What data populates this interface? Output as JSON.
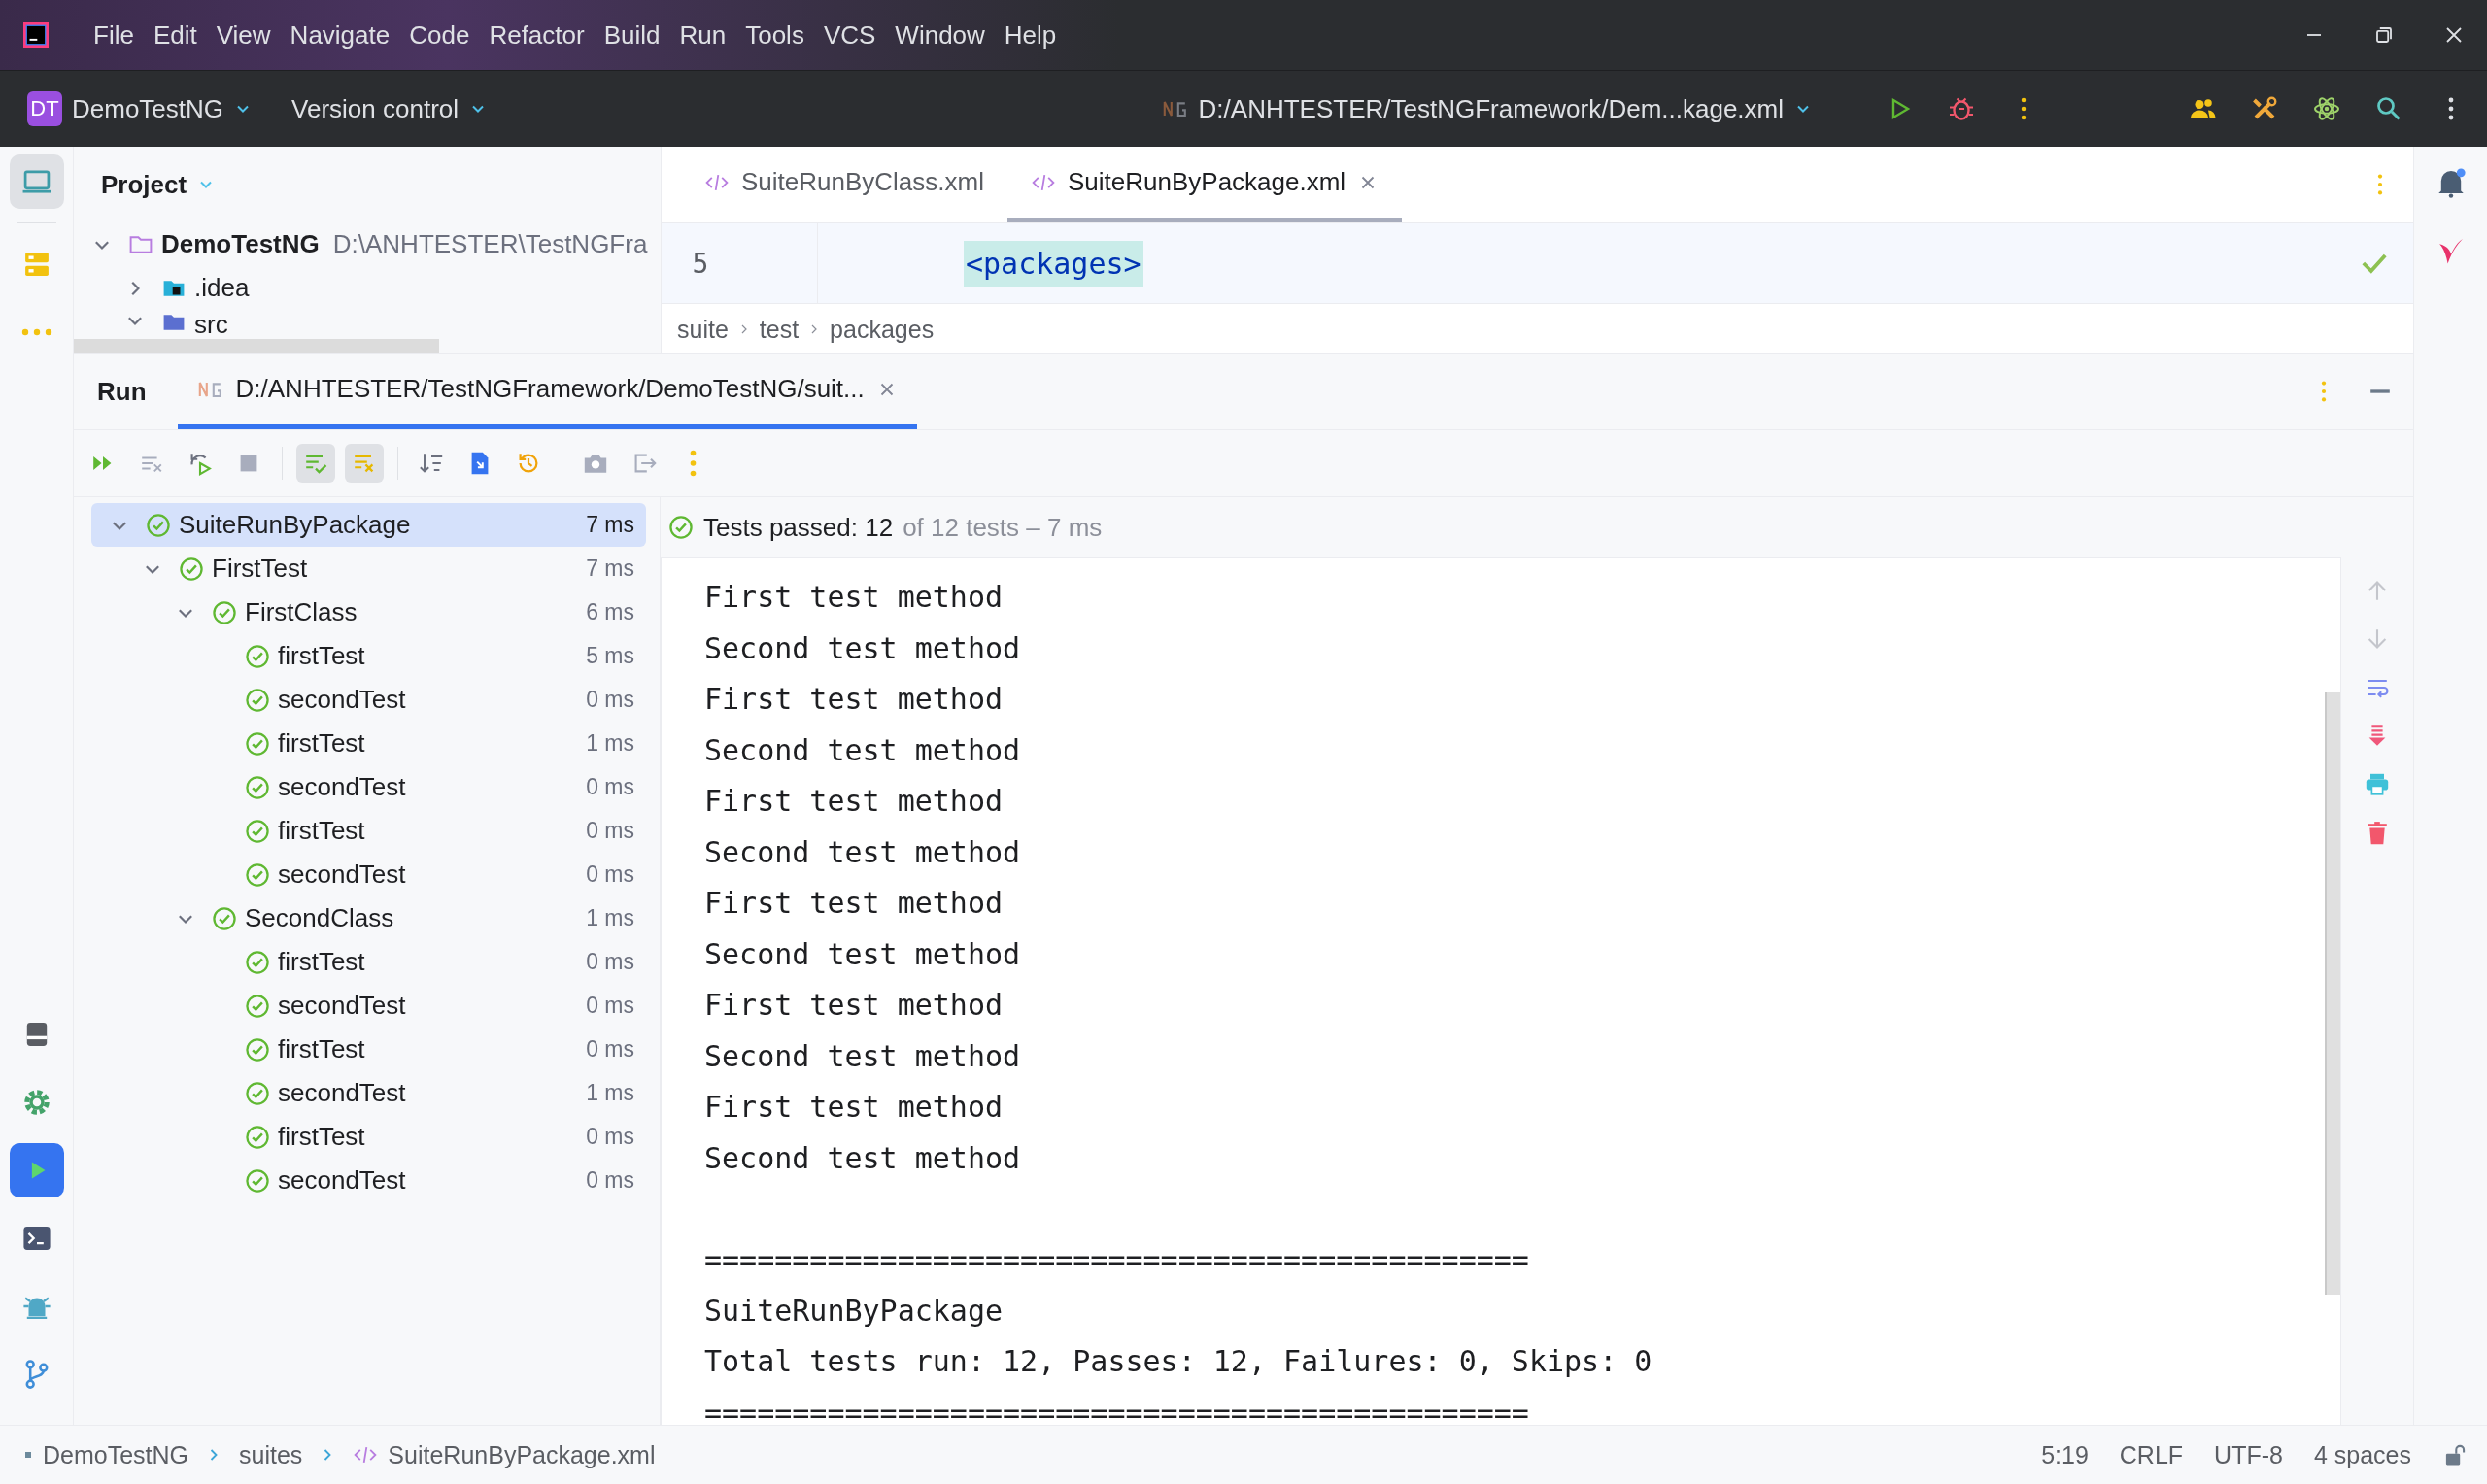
{
  "menu_bar": {
    "items": [
      "File",
      "Edit",
      "View",
      "Navigate",
      "Code",
      "Refactor",
      "Build",
      "Run",
      "Tools",
      "VCS",
      "Window",
      "Help"
    ]
  },
  "main_toolbar": {
    "project_badge": "DT",
    "project": "DemoTestNG",
    "version_control": "Version control",
    "run_configuration": "D:/ANHTESTER/TestNGFramework/Dem...kage.xml"
  },
  "left_stripe": [
    {
      "kind": "project",
      "selected": true
    },
    {
      "kind": "structure",
      "selected": false
    },
    {
      "kind": "more",
      "selected": false
    },
    {
      "kind": "bookmarks",
      "selected": false
    },
    {
      "kind": "settings",
      "selected": false
    },
    {
      "kind": "run",
      "selected": true
    },
    {
      "kind": "terminal",
      "selected": false
    },
    {
      "kind": "problems",
      "selected": false
    },
    {
      "kind": "git",
      "selected": false
    }
  ],
  "project_panel": {
    "title": "Project",
    "tree": [
      {
        "name": "DemoTestNG",
        "path": "D:\\ANHTESTER\\TestNGFra",
        "kind": "module",
        "expanded": true,
        "children": [
          {
            "name": ".idea",
            "kind": "folder",
            "expanded": false
          },
          {
            "name": "src",
            "kind": "source",
            "expanded": true
          }
        ]
      }
    ]
  },
  "editor": {
    "tabs": [
      {
        "label": "SuiteRunByClass.xml",
        "selected": false
      },
      {
        "label": "SuiteRunByPackage.xml",
        "selected": true
      }
    ],
    "line_number": "5",
    "code": "<packages>",
    "breadcrumbs": [
      "suite",
      "test",
      "packages"
    ]
  },
  "run": {
    "title": "Run",
    "tab": {
      "label": "D:/ANHTESTER/TestNGFramework/DemoTestNG/suit...",
      "selected": true
    },
    "toolbar": [
      {
        "kind": "rerun-failed",
        "toggled": false
      },
      {
        "kind": "clear",
        "toggled": false
      },
      {
        "kind": "rerun-auto",
        "toggled": false
      },
      {
        "kind": "stop",
        "toggled": false
      },
      {
        "kind": "show-passed",
        "toggled": true
      },
      {
        "kind": "show-ignored",
        "toggled": true
      },
      {
        "kind": "sort",
        "toggled": false
      },
      {
        "kind": "import",
        "toggled": false
      },
      {
        "kind": "history",
        "toggled": false
      },
      {
        "kind": "snapshot",
        "toggled": false
      },
      {
        "kind": "export",
        "toggled": false
      },
      {
        "kind": "more",
        "toggled": false
      }
    ],
    "tree": [
      {
        "name": "SuiteRunByPackage",
        "time": "7 ms",
        "selected": true,
        "expanded": true,
        "children": [
          {
            "name": "FirstTest",
            "time": "7 ms",
            "selected": false,
            "expanded": true,
            "children": [
              {
                "name": "FirstClass",
                "time": "6 ms",
                "selected": false,
                "expanded": true,
                "children": [
                  {
                    "name": "firstTest",
                    "time": "5 ms",
                    "selected": false
                  },
                  {
                    "name": "secondTest",
                    "time": "0 ms",
                    "selected": false
                  },
                  {
                    "name": "firstTest",
                    "time": "1 ms",
                    "selected": false
                  },
                  {
                    "name": "secondTest",
                    "time": "0 ms",
                    "selected": false
                  },
                  {
                    "name": "firstTest",
                    "time": "0 ms",
                    "selected": false
                  },
                  {
                    "name": "secondTest",
                    "time": "0 ms",
                    "selected": false
                  }
                ]
              },
              {
                "name": "SecondClass",
                "time": "1 ms",
                "selected": false,
                "expanded": true,
                "children": [
                  {
                    "name": "firstTest",
                    "time": "0 ms",
                    "selected": false
                  },
                  {
                    "name": "secondTest",
                    "time": "0 ms",
                    "selected": false
                  },
                  {
                    "name": "firstTest",
                    "time": "0 ms",
                    "selected": false
                  },
                  {
                    "name": "secondTest",
                    "time": "1 ms",
                    "selected": false
                  },
                  {
                    "name": "firstTest",
                    "time": "0 ms",
                    "selected": false
                  },
                  {
                    "name": "secondTest",
                    "time": "0 ms",
                    "selected": false
                  }
                ]
              }
            ]
          }
        ]
      }
    ],
    "summary": "Tests passed: 12",
    "summary_detail": "of 12 tests – 7 ms",
    "console_blocks": [
      [
        "First test method",
        "Second test method",
        "First test method",
        "Second test method",
        "First test method",
        "Second test method",
        "First test method",
        "Second test method",
        "First test method",
        "Second test method",
        "First test method",
        "Second test method"
      ],
      [
        "===============================================",
        "SuiteRunByPackage",
        "Total tests run: 12, Passes: 12, Failures: 0, Skips: 0",
        "==============================================="
      ]
    ]
  },
  "status_bar": {
    "breadcrumbs": [
      "DemoTestNG",
      "suites",
      "SuiteRunByPackage.xml"
    ],
    "items": [
      "5:19",
      "CRLF",
      "UTF-8",
      "4 spaces"
    ]
  }
}
